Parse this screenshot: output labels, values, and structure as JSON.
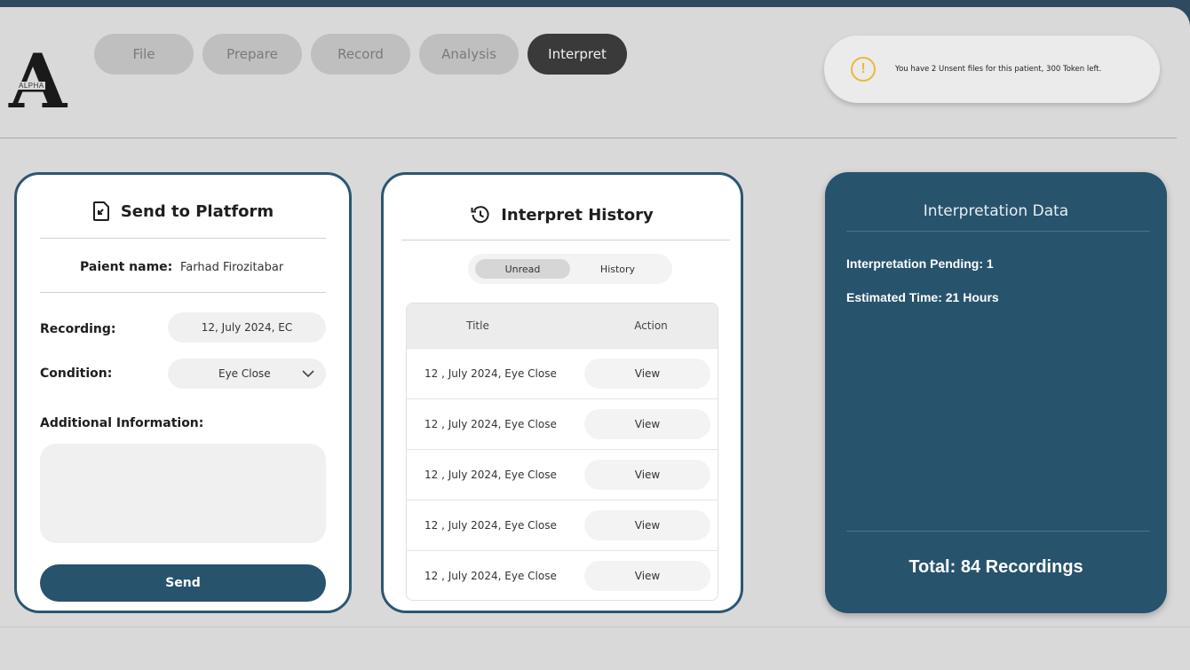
{
  "logo": {
    "glyph": "A",
    "text": "ALPHA"
  },
  "tabs": [
    {
      "label": "File",
      "active": false
    },
    {
      "label": "Prepare",
      "active": false
    },
    {
      "label": "Record",
      "active": false
    },
    {
      "label": "Analysis",
      "active": false
    },
    {
      "label": "Interpret",
      "active": true
    }
  ],
  "notice": {
    "icon": "warning-icon",
    "symbol": "!",
    "text": "You have 2 Unsent files for this patient, 300 Token left."
  },
  "send_card": {
    "title": "Send to Platform",
    "icon": "file-send-icon",
    "patient_label": "Paient name:",
    "patient_value": "Farhad Firozitabar",
    "recording_label": "Recording:",
    "recording_value": "12, July 2024,  EC",
    "condition_label": "Condition:",
    "condition_value": "Eye Close",
    "additional_label": "Additional Information:",
    "additional_value": "",
    "send_label": "Send"
  },
  "history_card": {
    "title": "Interpret History",
    "icon": "history-icon",
    "segments": [
      {
        "label": "Unread",
        "active": true
      },
      {
        "label": "History",
        "active": false
      }
    ],
    "columns": {
      "title": "Title",
      "action": "Action"
    },
    "rows": [
      {
        "title": "12 , July 2024, Eye Close",
        "action": "View"
      },
      {
        "title": "12 , July 2024, Eye Close",
        "action": "View"
      },
      {
        "title": "12 , July 2024, Eye Close",
        "action": "View"
      },
      {
        "title": "12 , July 2024, Eye Close",
        "action": "View"
      },
      {
        "title": "12 , July 2024, Eye Close",
        "action": "View"
      }
    ]
  },
  "data_card": {
    "title": "Interpretation Data",
    "pending": "Interpretation Pending: 1",
    "estimated": "Estimated Time: 21 Hours",
    "total": "Total: 84 Recordings"
  },
  "colors": {
    "accent": "#27536d",
    "warning": "#e8b93a",
    "background": "#d9d9d9",
    "frame": "#2f4a5e"
  }
}
